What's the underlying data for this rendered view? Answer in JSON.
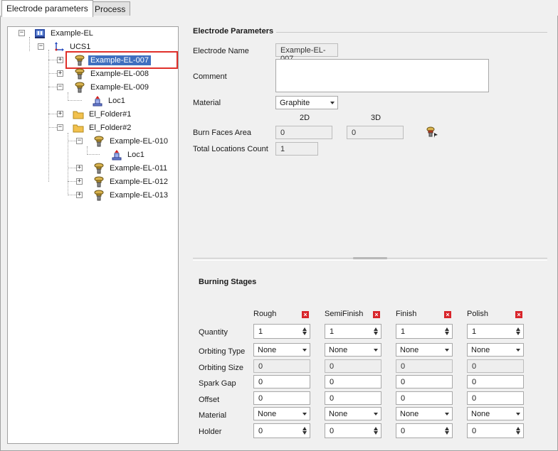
{
  "tabs": [
    {
      "label": "Electrode parameters",
      "active": true
    },
    {
      "label": "Process",
      "active": false
    }
  ],
  "tree": {
    "root": "Example-EL",
    "ucs": "UCS1",
    "items": [
      {
        "label": "Example-EL-007",
        "selected": true
      },
      {
        "label": "Example-EL-008"
      },
      {
        "label": "Example-EL-009"
      },
      {
        "label": "Loc1"
      },
      {
        "label": "El_Folder#1"
      },
      {
        "label": "El_Folder#2"
      },
      {
        "label": "Example-EL-010"
      },
      {
        "label": "Loc1"
      },
      {
        "label": "Example-EL-011"
      },
      {
        "label": "Example-EL-012"
      },
      {
        "label": "Example-EL-013"
      }
    ],
    "expand_signs": [
      "−",
      "−",
      "+",
      "+",
      "−",
      "+",
      "−",
      "−",
      "+",
      "+",
      "+"
    ]
  },
  "electrode_parameters": {
    "title": "Electrode Parameters",
    "name_label": "Electrode Name",
    "name_value": "Example-EL-007",
    "comment_label": "Comment",
    "comment_value": "",
    "material_label": "Material",
    "material_value": "Graphite",
    "col_2d": "2D",
    "col_3d": "3D",
    "burn_faces_label": "Burn Faces Area",
    "burn_2d": "0",
    "burn_3d": "0",
    "total_locations_label": "Total Locations Count",
    "total_locations_value": "1"
  },
  "burning_stages": {
    "title": "Burning Stages",
    "columns": [
      "Rough",
      "SemiFinish",
      "Finish",
      "Polish"
    ],
    "remove_glyph": "×",
    "row_labels": {
      "quantity": "Quantity",
      "orbiting_type": "Orbiting Type",
      "orbiting_size": "Orbiting Size",
      "spark_gap": "Spark Gap",
      "offset": "Offset",
      "material": "Material",
      "holder": "Holder"
    },
    "values": {
      "quantity": [
        "1",
        "1",
        "1",
        "1"
      ],
      "orbiting_type": [
        "None",
        "None",
        "None",
        "None"
      ],
      "orbiting_size": [
        "0",
        "0",
        "0",
        "0"
      ],
      "spark_gap": [
        "0",
        "0",
        "0",
        "0"
      ],
      "offset": [
        "0",
        "0",
        "0",
        "0"
      ],
      "material": [
        "None",
        "None",
        "None",
        "None"
      ],
      "holder": [
        "0",
        "0",
        "0",
        "0"
      ]
    }
  },
  "colors": {
    "selection": "#3f6fbf",
    "highlight_frame": "#e0302a",
    "remove_button": "#d8242a",
    "folder": "#f2c14e",
    "electrode_icon": "#c8a440"
  }
}
